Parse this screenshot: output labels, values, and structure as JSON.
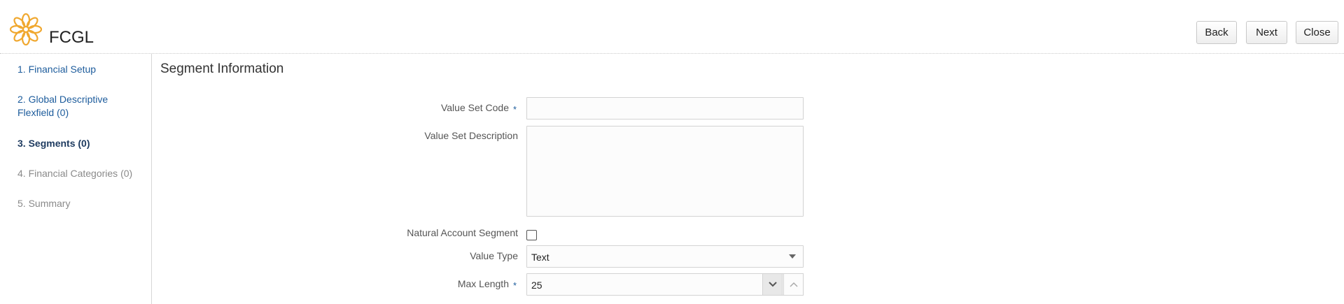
{
  "header": {
    "app_title": "FCGL",
    "logo_icon": "flower-logo-icon",
    "buttons": {
      "back": "Back",
      "next": "Next",
      "close": "Close"
    }
  },
  "train": {
    "steps": [
      {
        "label": "1. Financial Setup",
        "state": "link"
      },
      {
        "label": "2. Global Descriptive",
        "label2": "Flexfield (0)",
        "state": "link"
      },
      {
        "label": "3. Segments (0)",
        "state": "active"
      },
      {
        "label": "4. Financial Categories (0)",
        "state": "disabled"
      },
      {
        "label": "5. Summary",
        "state": "disabled"
      }
    ]
  },
  "form": {
    "section_title": "Segment Information",
    "required_marker": "*",
    "value_set_code": {
      "label": "Value Set Code",
      "value": ""
    },
    "value_set_description": {
      "label": "Value Set Description",
      "value": ""
    },
    "natural_account_segment": {
      "label": "Natural Account Segment",
      "checked": false
    },
    "value_type": {
      "label": "Value Type",
      "value": "Text"
    },
    "max_length": {
      "label": "Max Length",
      "value": "25"
    }
  },
  "colors": {
    "accent": "#1d5c9c",
    "logo": "#f0a830",
    "border": "#d3d3d3"
  }
}
